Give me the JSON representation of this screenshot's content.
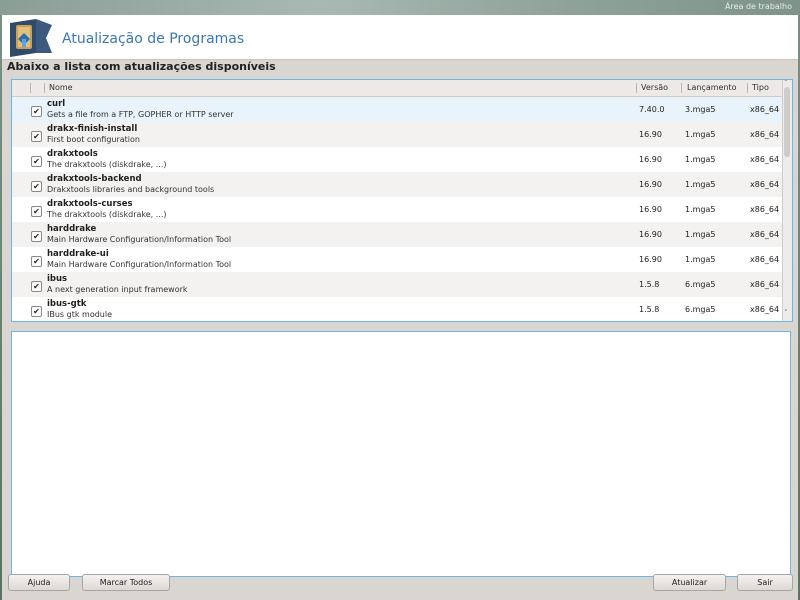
{
  "desktop": {
    "label": "Área de trabalho"
  },
  "window": {
    "title": "Atualização de Programas",
    "subtitle": "Abaixo a lista com atualizações disponíveis"
  },
  "columns": {
    "name": "Nome",
    "version": "Versão",
    "release": "Lançamento",
    "arch": "Tipo"
  },
  "packages": [
    {
      "name": "curl",
      "desc": "Gets a file from a FTP, GOPHER or HTTP server",
      "version": "7.40.0",
      "release": "3.mga5",
      "arch": "x86_64",
      "checked": "✔"
    },
    {
      "name": "drakx-finish-install",
      "desc": "First boot configuration",
      "version": "16.90",
      "release": "1.mga5",
      "arch": "x86_64",
      "checked": "✔"
    },
    {
      "name": "drakxtools",
      "desc": "The drakxtools (diskdrake, ...)",
      "version": "16.90",
      "release": "1.mga5",
      "arch": "x86_64",
      "checked": "✔"
    },
    {
      "name": "drakxtools-backend",
      "desc": "Drakxtools libraries and background tools",
      "version": "16.90",
      "release": "1.mga5",
      "arch": "x86_64",
      "checked": "✔"
    },
    {
      "name": "drakxtools-curses",
      "desc": "The drakxtools (diskdrake, ...)",
      "version": "16.90",
      "release": "1.mga5",
      "arch": "x86_64",
      "checked": "✔"
    },
    {
      "name": "harddrake",
      "desc": "Main Hardware Configuration/Information Tool",
      "version": "16.90",
      "release": "1.mga5",
      "arch": "x86_64",
      "checked": "✔"
    },
    {
      "name": "harddrake-ui",
      "desc": "Main Hardware Configuration/Information Tool",
      "version": "16.90",
      "release": "1.mga5",
      "arch": "x86_64",
      "checked": "✔"
    },
    {
      "name": "ibus",
      "desc": "A next generation input framework",
      "version": "1.5.8",
      "release": "6.mga5",
      "arch": "x86_64",
      "checked": "✔"
    },
    {
      "name": "ibus-gtk",
      "desc": "IBus gtk module",
      "version": "1.5.8",
      "release": "6.mga5",
      "arch": "x86_64",
      "checked": "✔"
    }
  ],
  "buttons": {
    "help": "Ajuda",
    "select_all": "Marcar Todos",
    "update": "Atualizar",
    "quit": "Sair"
  },
  "icons": {
    "scroll_up": "˄",
    "scroll_down": "˅"
  }
}
